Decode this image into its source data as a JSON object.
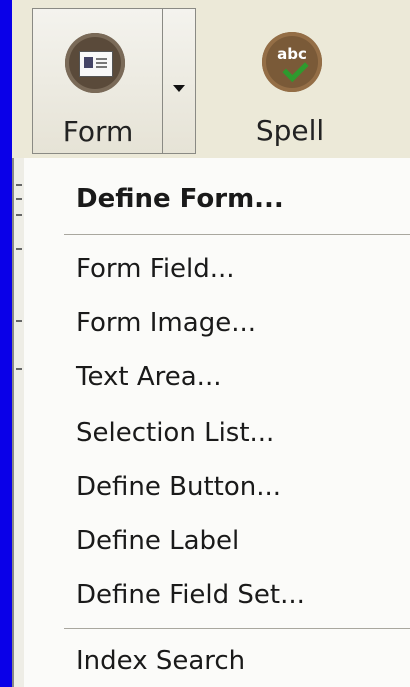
{
  "toolbar": {
    "form_label": "Form",
    "spell_label": "Spell",
    "spell_icon_text": "abc"
  },
  "menu": {
    "items": [
      {
        "label": "Define Form...",
        "bold": true
      },
      {
        "label": "Form Field..."
      },
      {
        "label": "Form Image..."
      },
      {
        "label": "Text Area..."
      },
      {
        "label": "Selection List..."
      },
      {
        "label": "Define Button..."
      },
      {
        "label": "Define Label"
      },
      {
        "label": "Define Field Set..."
      },
      {
        "label": "Index Search"
      }
    ]
  },
  "colors": {
    "background": "#0a00e8",
    "toolbar": "#ece9d8",
    "menu": "#fbfbf9"
  }
}
